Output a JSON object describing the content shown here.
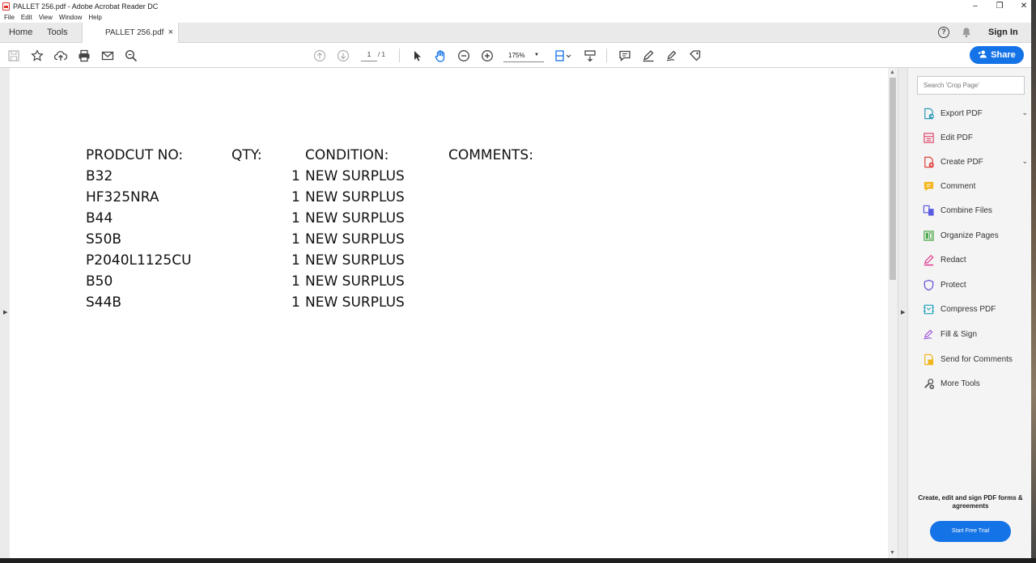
{
  "window": {
    "title": "PALLET 256.pdf - Adobe Acrobat Reader DC",
    "minimize": "–",
    "maximize": "❐",
    "close": "✕"
  },
  "menu": [
    "File",
    "Edit",
    "View",
    "Window",
    "Help"
  ],
  "tabs": {
    "home": "Home",
    "tools": "Tools",
    "document": "PALLET 256.pdf",
    "close": "×"
  },
  "account": {
    "help": "?",
    "sign_in": "Sign In"
  },
  "toolbar": {
    "page_current": "1",
    "page_total": "/ 1",
    "zoom": "175%",
    "zoom_dropdown": "▼",
    "share_label": "Share"
  },
  "document": {
    "headers": {
      "product": "PRODCUT NO:",
      "qty": "QTY:",
      "condition": "CONDITION:",
      "comments": "COMMENTS:"
    },
    "rows": [
      {
        "product": "B32",
        "qty": "1",
        "condition": "NEW SURPLUS"
      },
      {
        "product": "HF325NRA",
        "qty": "1",
        "condition": "NEW SURPLUS"
      },
      {
        "product": "B44",
        "qty": "1",
        "condition": "NEW SURPLUS"
      },
      {
        "product": "S50B",
        "qty": "1",
        "condition": "NEW SURPLUS"
      },
      {
        "product": "P2040L1125CU",
        "qty": "1",
        "condition": "NEW SURPLUS"
      },
      {
        "product": "B50",
        "qty": "1",
        "condition": "NEW SURPLUS"
      },
      {
        "product": "S44B",
        "qty": "1",
        "condition": "NEW SURPLUS"
      }
    ]
  },
  "right_panel": {
    "search_placeholder": "Search 'Crop Page'",
    "tools": [
      {
        "label": "Export PDF",
        "icon": "export-pdf-icon",
        "color": "#2b9ab5",
        "expand": true
      },
      {
        "label": "Edit PDF",
        "icon": "edit-pdf-icon",
        "color": "#e14a6e",
        "expand": false
      },
      {
        "label": "Create PDF",
        "icon": "create-pdf-icon",
        "color": "#e0413a",
        "expand": true
      },
      {
        "label": "Comment",
        "icon": "comment-icon",
        "color": "#f2b51a",
        "expand": false
      },
      {
        "label": "Combine Files",
        "icon": "combine-files-icon",
        "color": "#5a5be0",
        "expand": false
      },
      {
        "label": "Organize Pages",
        "icon": "organize-pages-icon",
        "color": "#4fab4b",
        "expand": false
      },
      {
        "label": "Redact",
        "icon": "redact-icon",
        "color": "#e03a8e",
        "expand": false
      },
      {
        "label": "Protect",
        "icon": "protect-icon",
        "color": "#6a5bd6",
        "expand": false
      },
      {
        "label": "Compress PDF",
        "icon": "compress-pdf-icon",
        "color": "#2ca8c2",
        "expand": false
      },
      {
        "label": "Fill & Sign",
        "icon": "fill-sign-icon",
        "color": "#9d55d6",
        "expand": false
      },
      {
        "label": "Send for Comments",
        "icon": "send-for-comments-icon",
        "color": "#f2b51a",
        "expand": false
      },
      {
        "label": "More Tools",
        "icon": "more-tools-icon",
        "color": "#555555",
        "expand": false
      }
    ],
    "promo": "Create, edit and sign PDF forms & agreements",
    "trial_button": "Start Free Trial"
  },
  "colors": {
    "accent": "#1473e6"
  }
}
